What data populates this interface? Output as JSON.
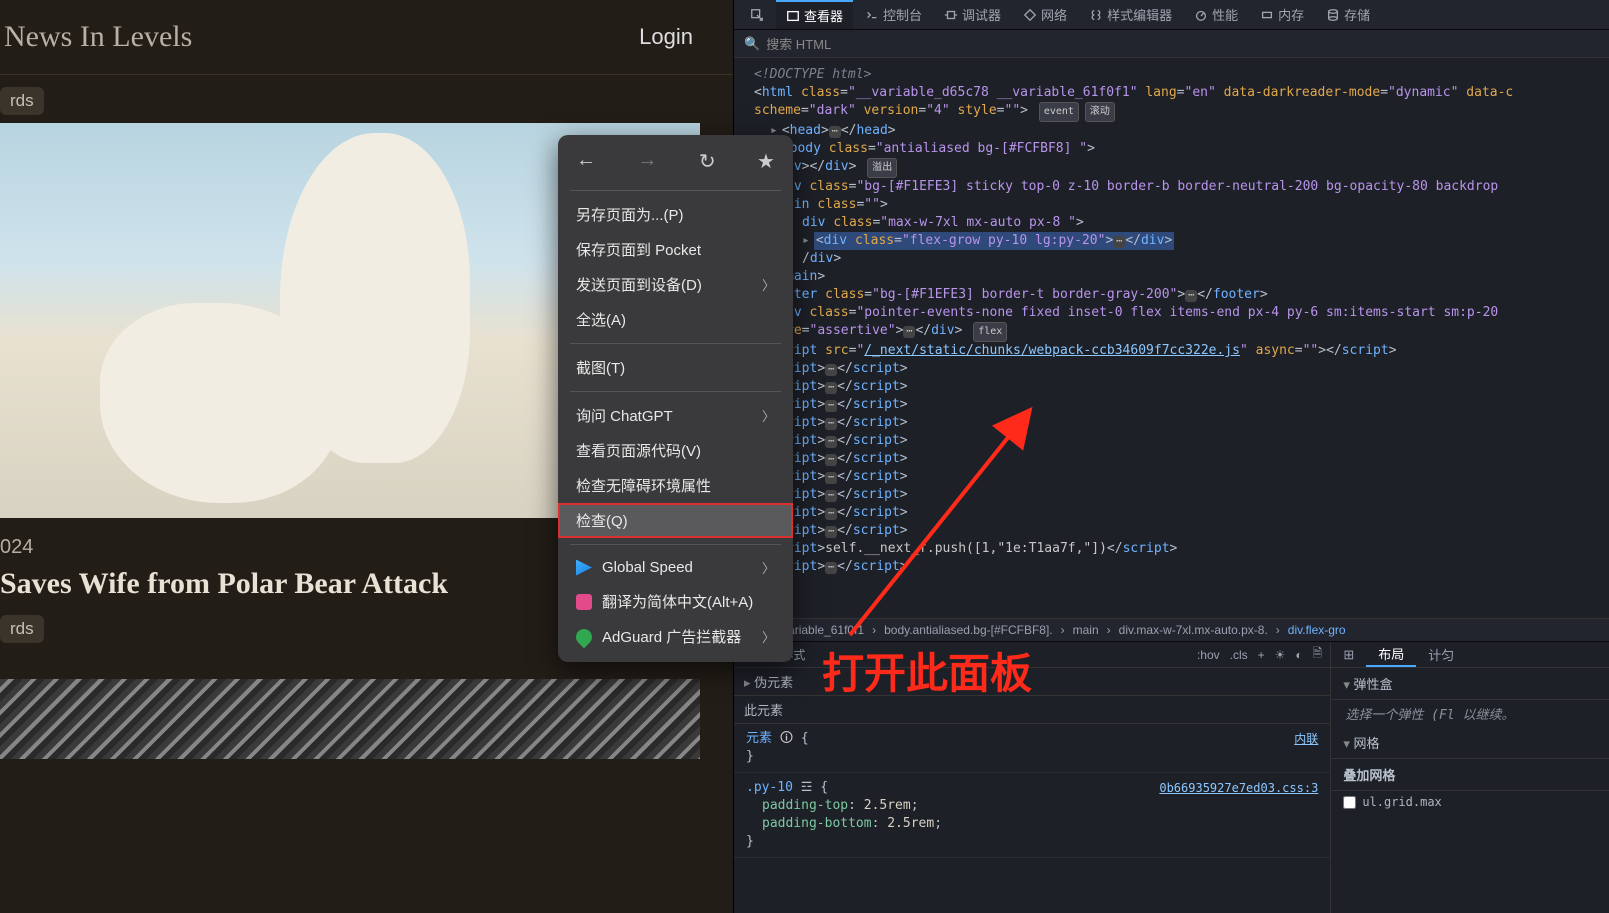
{
  "page": {
    "site_title": "News In Levels",
    "login": "Login",
    "chip1": "rds",
    "article_date": "024",
    "article_title": "Saves Wife from Polar Bear Attack",
    "chip2": "rds"
  },
  "context_menu": {
    "save_as": "另存页面为...(P)",
    "save_pocket": "保存页面到 Pocket",
    "send_device": "发送页面到设备(D)",
    "select_all": "全选(A)",
    "screenshot": "截图(T)",
    "ask_chatgpt": "询问 ChatGPT",
    "view_source": "查看页面源代码(V)",
    "a11y": "检查无障碍环境属性",
    "inspect": "检查(Q)",
    "global_speed": "Global Speed",
    "translate": "翻译为简体中文(Alt+A)",
    "adguard": "AdGuard 广告拦截器"
  },
  "devtools": {
    "tabs": {
      "inspector": "查看器",
      "console": "控制台",
      "debugger": "调试器",
      "network": "网络",
      "style_editor": "样式编辑器",
      "performance": "性能",
      "memory": "内存",
      "storage": "存储"
    },
    "search_placeholder": "搜索 HTML",
    "dom": {
      "doctype": "<!DOCTYPE html>",
      "html_open_a": "html",
      "html_class": "__variable_d65c78 __variable_61f0f1",
      "html_lang": "en",
      "html_darkreader": "dynamic",
      "html_scheme": "dark",
      "html_version": "4",
      "badge_event": "event",
      "badge_scroll": "滚动",
      "head": "head",
      "body_class": "antialiased bg-[#FCFBF8] ",
      "div_close": "div",
      "badge_overflow": "溢出",
      "sticky_class": "bg-[#F1EFE3] sticky top-0 z-10 border-b border-neutral-200 bg-opacity-80 backdrop",
      "main": "main",
      "maxw_class": "max-w-7xl mx-auto px-8 ",
      "selected_class": "flex-grow py-10 lg:py-20",
      "footer_class": "bg-[#F1EFE3] border-t border-gray-200",
      "pointer_class": "pointer-events-none fixed inset-0 flex items-end px-4 py-6 sm:items-start sm:p-20",
      "assertive": "assertive",
      "badge_flex": "flex",
      "script_src": "/_next/static/chunks/webpack-ccb34609f7cc322e.js",
      "script_async": "async",
      "script_push": "self.__next_f.push([1,\"1e:T1aa7f,\"])"
    },
    "breadcrumb": {
      "b1": "c78.__variable_61f0f1",
      "b2": "body.antialiased.bg-[#FCFBF8].",
      "b3": "main",
      "b4": "div.max-w-7xl.mx-auto.px-8.",
      "b5": "div.flex-gro"
    },
    "styles": {
      "filter": "过滤样式",
      "hov": ":hov",
      "cls": ".cls",
      "pseudo": "伪元素",
      "this_element": "此元素",
      "element_sel": "元素",
      "inline": "内联",
      "py10_sel": ".py-10",
      "icon_ref": "☲",
      "css_source": "0b66935927e7ed03.css:3",
      "ptop": "padding-top",
      "ptop_val": "2.5rem",
      "pbot": "padding-bottom",
      "pbot_val": "2.5rem"
    },
    "layout": {
      "tab_layout": "布局",
      "tab_compute": "计匀",
      "flexbox": "弹性盒",
      "flex_help": "选择一个弹性 (Fl 以继续。",
      "grid": "网格",
      "overlay_grid": "叠加网格",
      "grid_item": "ul.grid.max"
    }
  },
  "annotation": {
    "text": "打开此面板"
  }
}
